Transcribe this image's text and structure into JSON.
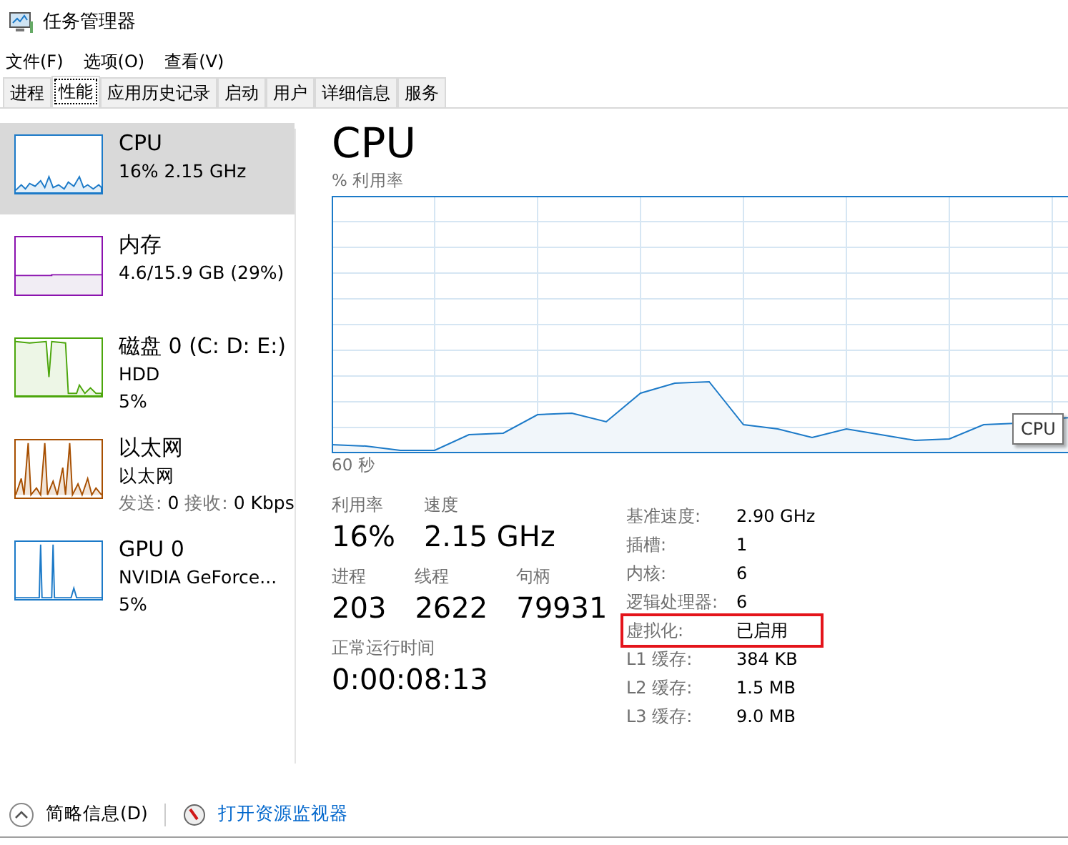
{
  "window": {
    "title": "任务管理器"
  },
  "menu": [
    "文件(F)",
    "选项(O)",
    "查看(V)"
  ],
  "tabs": [
    {
      "label": "进程",
      "selected": false
    },
    {
      "label": "性能",
      "selected": true
    },
    {
      "label": "应用历史记录",
      "selected": false
    },
    {
      "label": "启动",
      "selected": false
    },
    {
      "label": "用户",
      "selected": false
    },
    {
      "label": "详细信息",
      "selected": false
    },
    {
      "label": "服务",
      "selected": false
    }
  ],
  "sidebar": {
    "items": [
      {
        "name": "CPU",
        "lines": [
          "16% 2.15 GHz"
        ],
        "color": "#1c7ac8",
        "selected": true
      },
      {
        "name": "内存",
        "lines": [
          "4.6/15.9 GB (29%)"
        ],
        "color": "#8b12ae",
        "selected": false
      },
      {
        "name": "磁盘 0 (C: D: E:)",
        "lines": [
          "HDD",
          "5%"
        ],
        "color": "#4ca60c",
        "selected": false
      },
      {
        "name": "以太网",
        "lines": [
          "以太网"
        ],
        "stats": [
          {
            "label": "发送:",
            "value": "0"
          },
          {
            "label": "接收:",
            "value": "0 Kbps"
          }
        ],
        "color": "#a74f01",
        "selected": false
      },
      {
        "name": "GPU 0",
        "lines": [
          "NVIDIA GeForce...",
          "5%"
        ],
        "color": "#1c7ac8",
        "selected": false
      }
    ]
  },
  "main": {
    "title": "CPU",
    "chart_label": "% 利用率",
    "chart_footer": "60 秒",
    "tooltip": "CPU",
    "stats": [
      [
        {
          "label": "利用率",
          "value": "16%"
        },
        {
          "label": "速度",
          "value": "2.15 GHz"
        }
      ],
      [
        {
          "label": "进程",
          "value": "203"
        },
        {
          "label": "线程",
          "value": "2622"
        },
        {
          "label": "句柄",
          "value": "79931"
        }
      ],
      [
        {
          "label": "正常运行时间",
          "value": "0:00:08:13"
        }
      ]
    ],
    "specs": [
      {
        "label": "基准速度:",
        "value": "2.90 GHz",
        "highlighted": false
      },
      {
        "label": "插槽:",
        "value": "1",
        "highlighted": false
      },
      {
        "label": "内核:",
        "value": "6",
        "highlighted": false
      },
      {
        "label": "逻辑处理器:",
        "value": "6",
        "highlighted": false
      },
      {
        "label": "虚拟化:",
        "value": "已启用",
        "highlighted": true
      },
      {
        "label": "L1 缓存:",
        "value": "384 KB",
        "highlighted": false
      },
      {
        "label": "L2 缓存:",
        "value": "1.5 MB",
        "highlighted": false
      },
      {
        "label": "L3 缓存:",
        "value": "9.0 MB",
        "highlighted": false
      }
    ]
  },
  "footer": {
    "summary": "简略信息(D)",
    "monitor_link": "打开资源监视器"
  }
}
